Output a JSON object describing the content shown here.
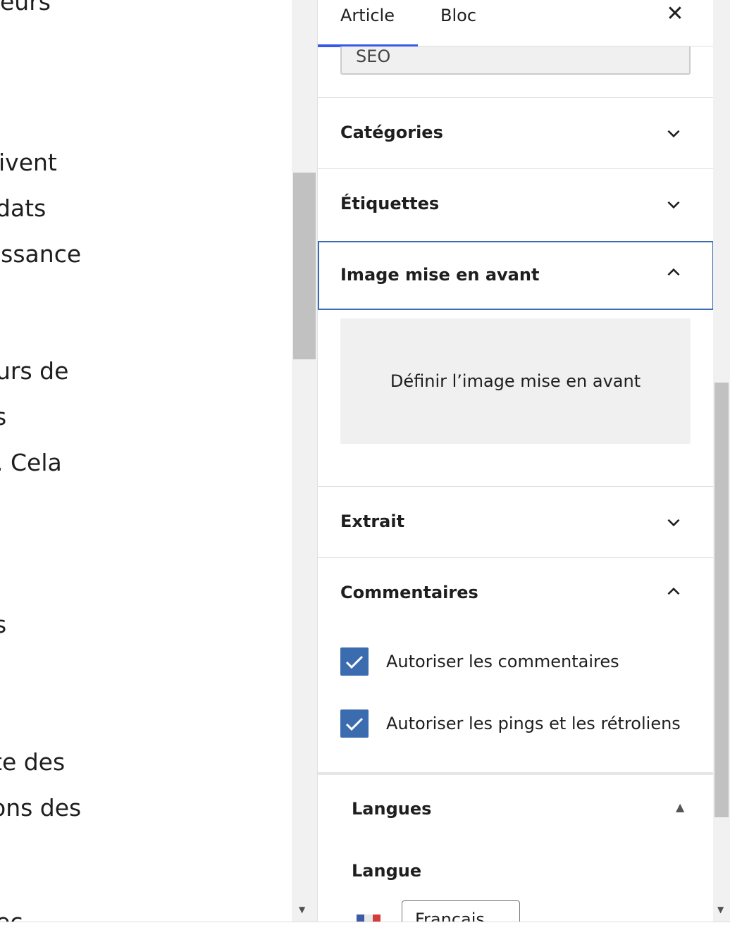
{
  "editor": {
    "lines": [
      "eurs",
      "ivent",
      "dats",
      "issance",
      "urs de",
      "s",
      ". Cela",
      "s",
      "te des",
      "ons des",
      "ec"
    ]
  },
  "sidebar": {
    "tabs": {
      "article": "Article",
      "bloc": "Bloc"
    },
    "close_glyph": "✕",
    "seo_value": "SEO",
    "panels": {
      "categories": "Catégories",
      "etiquettes": "Étiquettes",
      "featured_image": "Image mise en avant",
      "extrait": "Extrait",
      "commentaires": "Commentaires"
    },
    "featured_image_button": "Définir l’image mise en avant",
    "comments": {
      "allow_comments": "Autoriser les commentaires",
      "allow_pings": "Autoriser les pings et les rétroliens"
    },
    "languages": {
      "title": "Langues",
      "toggle_glyph": "▲",
      "language_label": "Langue",
      "selected_language": "Français",
      "flag_colors": [
        "#3c5aa6",
        "#ffffff",
        "#d43c3c"
      ]
    }
  },
  "colors": {
    "accent": "#3858e9",
    "focus_border": "#3c6cb0",
    "checkbox": "#3c6cb0"
  }
}
